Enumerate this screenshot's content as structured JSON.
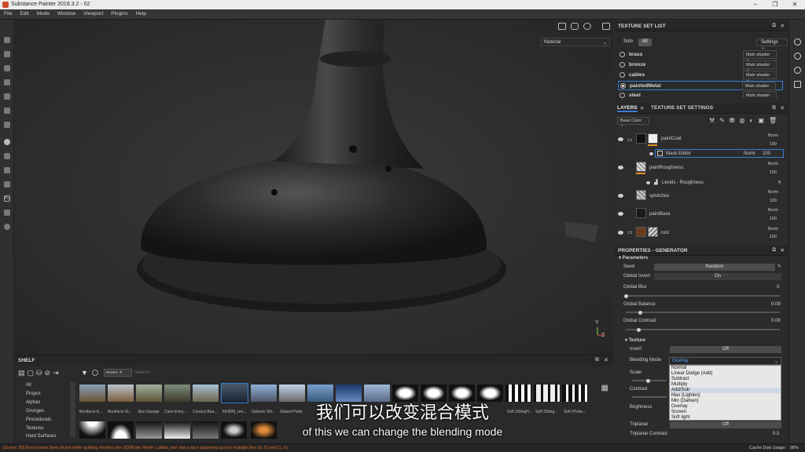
{
  "window": {
    "title": "Substance Painter 2018.3.2 - 02"
  },
  "menu": [
    "File",
    "Edit",
    "Mode",
    "Window",
    "Viewport",
    "Plugins",
    "Help"
  ],
  "viewport": {
    "material_select": "Material",
    "axis_y": "Y",
    "axis_z": "Z"
  },
  "texture_set_list": {
    "title": "TEXTURE SET LIST",
    "solo": "Solo",
    "all": "All",
    "settings": "Settings",
    "items": [
      {
        "name": "brass",
        "shader": "Main shader"
      },
      {
        "name": "bronze",
        "shader": "Main shader"
      },
      {
        "name": "cables",
        "shader": "Main shader"
      },
      {
        "name": "paintedMetal",
        "shader": "Main shader"
      },
      {
        "name": "steel",
        "shader": "Main shader"
      }
    ]
  },
  "layers": {
    "tab_layers": "LAYERS",
    "tab_settings": "TEXTURE SET SETTINGS",
    "channel": "Base Color",
    "rows": [
      {
        "name": "paintCoat",
        "blend": "Norm",
        "opacity": "100"
      },
      {
        "name": "Mask Editor",
        "blend": "Norm",
        "opacity": "100"
      },
      {
        "name": "paintRoughness",
        "blend": "Norm",
        "opacity": "100"
      },
      {
        "name": "Levels - Roughness"
      },
      {
        "name": "splotches",
        "blend": "Norm",
        "opacity": "100"
      },
      {
        "name": "paintBase",
        "blend": "Norm",
        "opacity": "100"
      },
      {
        "name": "rust",
        "blend": "Norm",
        "opacity": "100"
      }
    ]
  },
  "properties": {
    "title": "PROPERTIES - GENERATOR",
    "parameters": "Parameters",
    "seed_label": "Seed",
    "seed_btn": "Random",
    "global_invert": "Global Invert",
    "global_invert_val": "On",
    "global_blur": "Global Blur",
    "global_blur_val": "0",
    "global_balance": "Global Balance",
    "global_balance_val": "0.09",
    "global_contrast": "Global Contrast",
    "global_contrast_val": "0.08",
    "texture": "Texture",
    "invert": "Invert",
    "invert_val": "Off",
    "blending_mode": "Blending Mode",
    "blending_value": "Overlay",
    "blend_options": [
      "Normal",
      "Linear Dodge (Add)",
      "Subtract",
      "Multiply",
      "Add/Sub",
      "Max (Lighten)",
      "Min (Darken)",
      "Overlay",
      "Screen",
      "Soft light"
    ],
    "scale": "Scale",
    "contrast": "Contrast",
    "brightness": "Brightness",
    "triplanar": "Triplanar",
    "triplanar_val": "Off",
    "triplanar_contrast": "Triplanar Contrast",
    "triplanar_contrast_val": "0.5"
  },
  "shelf": {
    "title": "SHELF",
    "filter": "enviro",
    "search_placeholder": "Search...",
    "categories": [
      "All",
      "Project",
      "Alphas",
      "Grunges",
      "Procedurals",
      "Textures",
      "Hard Surfaces"
    ],
    "tiles": [
      "Bonifacio A...",
      "Bonifacio St...",
      "Bus Garage",
      "Cave Entry ...",
      "Corsica Bea...",
      "fnHDRI_ren...",
      "Gdansk Shi...",
      "Glazed Patio",
      "",
      "",
      "",
      "",
      "",
      "",
      "Soft 3SlingH...",
      "Soft 3Sling...",
      "Soft 4Tube..."
    ]
  },
  "status": {
    "error": "[Scene 3D] Errors have been found while splitting meshes per UDIM tile: Mesh 'cables_low' has a face spanning across multiple tiles (0, 0) and (1, 0)",
    "cache_label": "Cache Disk Usage:",
    "cache_val": "98%"
  },
  "subtitle": {
    "cn": "我们可以改变混合模式",
    "en": "of this we can change the blending mode"
  }
}
